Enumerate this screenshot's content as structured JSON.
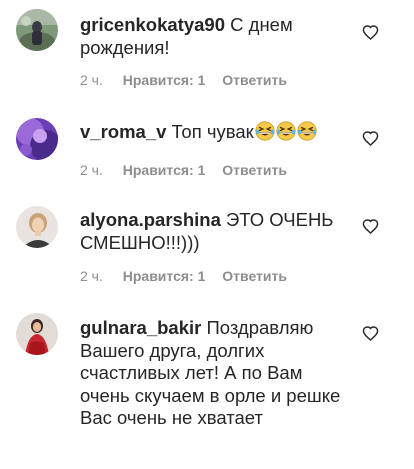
{
  "comments": [
    {
      "username": "gricenkokatya90",
      "text": "С днем рождения!",
      "time": "2 ч.",
      "likes": "Нравится: 1",
      "reply": "Ответить"
    },
    {
      "username": "v_roma_v",
      "text": "Топ чувак",
      "emojis": [
        "grinning-squinting-face-icon",
        "grinning-squinting-face-icon",
        "grinning-squinting-face-icon"
      ],
      "time": "2 ч.",
      "likes": "Нравится: 1",
      "reply": "Ответить"
    },
    {
      "username": "alyona.parshina",
      "text": "ЭТО ОЧЕНЬ СМЕШНО!!!)))",
      "time": "2 ч.",
      "likes": "Нравится: 1",
      "reply": "Ответить"
    },
    {
      "username": "gulnara_bakir",
      "text": "Поздравляю Вашего друга, долгих счастливых лет! А по Вам очень скучаем в орле и решке Вас очень не хватает",
      "time": "",
      "likes": "",
      "reply": ""
    }
  ],
  "icons": {
    "like": "heart-outline-icon"
  },
  "colors": {
    "text": "#262626",
    "secondary": "#8e8e8e",
    "background": "#ffffff"
  }
}
